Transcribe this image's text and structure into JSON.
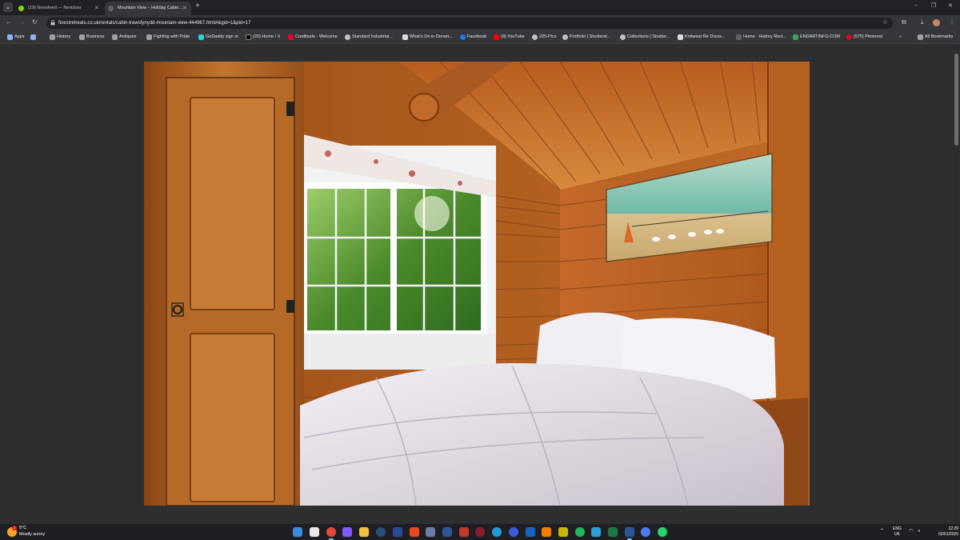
{
  "browser": {
    "tabs": [
      {
        "label": "(19) Newsfeed — Nextdoor",
        "favicon_color": "#8ed500"
      },
      {
        "label": "Mountain View – Holiday Cabin…",
        "favicon_color": "#4a4a4a"
      }
    ],
    "new_tab": "+",
    "url": "finestretreats.co.uk/rentals/cabin-trawsfynydd-mountain-view-444967.html#&gid=1&pid=17",
    "window_controls": [
      "–",
      "❐",
      "✕"
    ]
  },
  "bookmarks": [
    {
      "label": "Apps",
      "icon_color": "#8ab4f8"
    },
    {
      "label": "",
      "icon_color": "#8ab4f8"
    },
    {
      "label": "History",
      "icon_color": "#9aa0a6"
    },
    {
      "label": "Business",
      "icon_color": "#9aa0a6"
    },
    {
      "label": "Antiques",
      "icon_color": "#9aa0a6"
    },
    {
      "label": "Fighting with Pride",
      "icon_color": "#9aa0a6"
    },
    {
      "label": "GoDaddy sign in",
      "icon_color": "#1bdbdb"
    },
    {
      "label": "(20) Home / X",
      "icon_color": "#000000"
    },
    {
      "label": "Creditsafe - Welcome",
      "icon_color": "#e4002b"
    },
    {
      "label": "Standard Industrial...",
      "icon_color": "#bdc1c6"
    },
    {
      "label": "What's On in Dorset...",
      "icon_color": "#dadce0"
    },
    {
      "label": "Facebook",
      "icon_color": "#1877f2"
    },
    {
      "label": "(8) YouTube",
      "icon_color": "#ff0000"
    },
    {
      "label": "225-Pics",
      "icon_color": "#bdc1c6"
    },
    {
      "label": "Portfolio | Shutterst...",
      "icon_color": "#bdc1c6"
    },
    {
      "label": "Collections | Shutter...",
      "icon_color": "#bdc1c6"
    },
    {
      "label": "Knitwear Re Dress...",
      "icon_color": "#dadce0"
    },
    {
      "label": "Home - History Recl...",
      "icon_color": "#3c4043"
    },
    {
      "label": "ENDARTINFO.COM",
      "icon_color": "#34a853"
    },
    {
      "label": "(575) Pinterest",
      "icon_color": "#e60023"
    },
    {
      "label": "All Bookmarks",
      "icon_color": "#9aa0a6"
    }
  ],
  "weather": {
    "temp": "5°C",
    "desc": "Mostly sunny",
    "badge": "1"
  },
  "system": {
    "lang_1": "ENG",
    "lang_2": "UK",
    "time": "12:29",
    "date": "02/01/2025"
  }
}
